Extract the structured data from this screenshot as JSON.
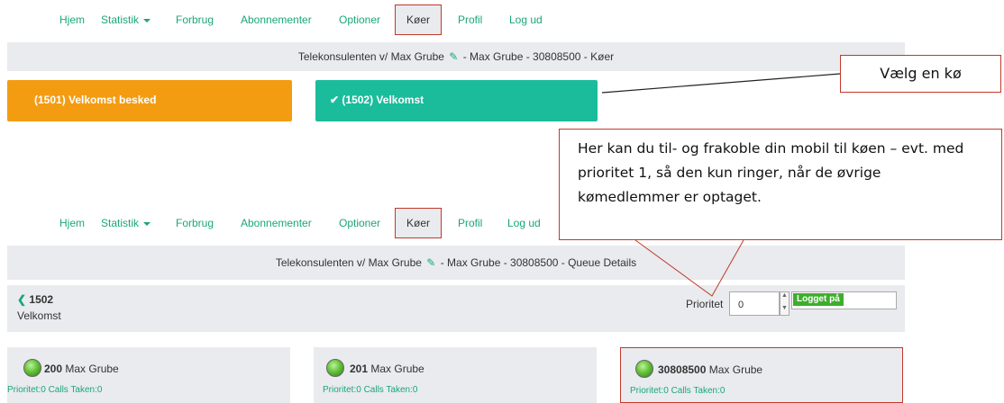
{
  "nav": {
    "items": [
      "Hjem",
      "Statistik",
      "Forbrug",
      "Abonnementer",
      "Optioner",
      "Køer",
      "Profil",
      "Log ud"
    ]
  },
  "top": {
    "header_bar": "Telekonsulenten v/ Max Grube",
    "header_bar_rest": "- Max Grube - 30808500 - Køer",
    "queue_1": "(1501) Velkomst besked",
    "queue_2": "(1502) Velkomst",
    "callout": "Vælg en kø"
  },
  "bottom": {
    "header_bar": "Telekonsulenten v/ Max Grube",
    "header_bar_rest": "- Max Grube - 30808500 - Queue Details",
    "back_number": "1502",
    "back_name": "Velkomst",
    "priority_label": "Prioritet",
    "priority_value": "0",
    "status_badge": "Logget på",
    "callout": "Her kan du til- og frakoble din mobil til køen – evt. med prioritet 1, så den kun ringer, når de øvrige kømedlemmer er optaget.",
    "members": [
      {
        "number": "200",
        "name": "Max Grube",
        "stats": "Prioritet:0 Calls Taken:0"
      },
      {
        "number": "201",
        "name": "Max Grube",
        "stats": "Prioritet:0 Calls Taken:0"
      },
      {
        "number": "30808500",
        "name": "Max Grube",
        "stats": "Prioritet:0 Calls Taken:0"
      }
    ]
  },
  "colors": {
    "accent": "#1aa67a",
    "orange": "#f39c12",
    "teal": "#1abc9c",
    "highlight": "#c0392b",
    "panel": "#e9ebee"
  }
}
